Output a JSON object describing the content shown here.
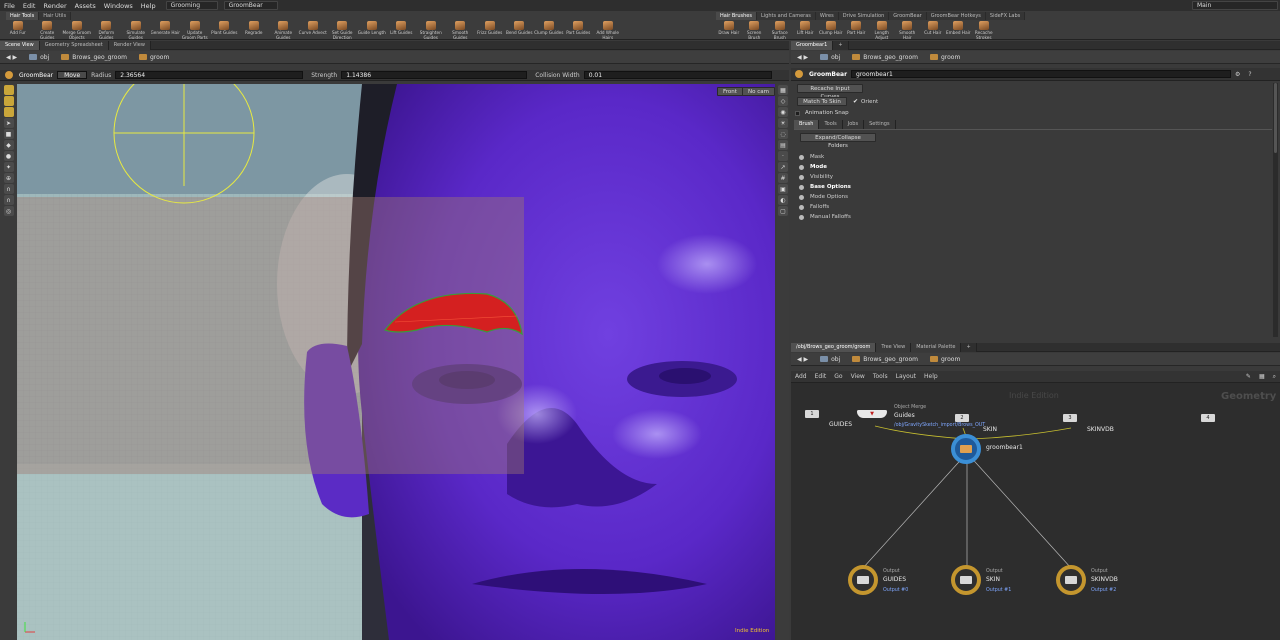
{
  "menu": [
    "File",
    "Edit",
    "Render",
    "Assets",
    "Windows",
    "Help"
  ],
  "desktop": "Grooming",
  "groom_object": "GroomBear",
  "workspace": "Main",
  "shelf_tabs_left": [
    "Hair Tools",
    "Hair Utils"
  ],
  "shelf_tools_left": [
    "Add Fur",
    "Create Guides",
    "Merge Groom Objects",
    "Deform Guides",
    "Simulate Guides",
    "Generate Hair",
    "Update Groom Parts",
    "Plant Guides",
    "Regrade",
    "Animate Guides",
    "Curve Advect",
    "Set Guide Direction",
    "Guide Length",
    "Lift Guides",
    "Straighten Guides",
    "Smooth Guides",
    "Frizz Guides",
    "Bend Guides",
    "Clump Guides",
    "Part Guides",
    "Add Whole Hairs"
  ],
  "shelf_tabs_right": [
    "Hair Brushes",
    "Lights and Cameras",
    "Wires",
    "Drive Simulation",
    "GroomBear",
    "GroomBear Hotkeys",
    "SideFX Labs"
  ],
  "shelf_tools_right": [
    "Draw Hair",
    "Screen Brush",
    "Surface Brush",
    "Lift Hair",
    "Clump Hair",
    "Part Hair",
    "Length Adjust",
    "Smooth Hair",
    "Cut Hair",
    "Embed Hair",
    "Recache Strokes"
  ],
  "left_tabs": [
    "Scene View",
    "Geometry Spreadsheet",
    "Render View"
  ],
  "path_left": {
    "root": "obj",
    "a": "Brows_geo_groom",
    "b": "groom"
  },
  "op": {
    "name": "GroomBear",
    "mode": "Move",
    "radius_label": "Radius",
    "radius": "2.36564",
    "strength_label": "Strength",
    "strength": "1.14386",
    "collision_label": "Collision Width",
    "collision": "0.01"
  },
  "viewport": {
    "cam_front": "Front",
    "cam_no": "No cam",
    "watermark": "Indie Edition"
  },
  "params_tab": "Groombear1",
  "path_right": {
    "root": "obj",
    "a": "Brows_geo_groom",
    "b": "groom"
  },
  "node": {
    "type": "GroomBear",
    "name": "groombear1"
  },
  "buttons": {
    "recache": "Recache Input Curves",
    "match": "Match To Skin",
    "orient": "Orient",
    "anim_snap": "Animation Snap"
  },
  "subtabs": [
    "Brush",
    "Tools",
    "Jobs",
    "Settings"
  ],
  "expand": "Expand/Collapse Folders",
  "folders": [
    {
      "label": "Mask",
      "bold": false
    },
    {
      "label": "Mode",
      "bold": true
    },
    {
      "label": "Visibility",
      "bold": false
    },
    {
      "label": "Base Options",
      "bold": true
    },
    {
      "label": "Mode Options",
      "bold": false
    },
    {
      "label": "Falloffs",
      "bold": false
    },
    {
      "label": "Manual Falloffs",
      "bold": false
    }
  ],
  "net_tabs": [
    "/obj/Brows_geo_groom/groom",
    "Tree View",
    "Material Palette"
  ],
  "net_menu": [
    "Add",
    "Edit",
    "Go",
    "View",
    "Tools",
    "Layout",
    "Help"
  ],
  "net": {
    "watermark": "Indie Edition",
    "context": "Geometry",
    "n1": "1",
    "n1_label": "GUIDES",
    "merge_type": "Object Merge",
    "merge_name": "Guides",
    "merge_path": "/obj/GravitySketch_import/Brows_OUT",
    "n2": "2",
    "n2_label": "SKIN",
    "n3": "3",
    "n3_label": "SKINVDB",
    "n4": "4",
    "groom": "groombear1",
    "outputs": [
      {
        "type": "Output",
        "name": "GUIDES",
        "sub": "Output #0"
      },
      {
        "type": "Output",
        "name": "SKIN",
        "sub": "Output #1"
      },
      {
        "type": "Output",
        "name": "SKINVDB",
        "sub": "Output #2"
      }
    ]
  }
}
